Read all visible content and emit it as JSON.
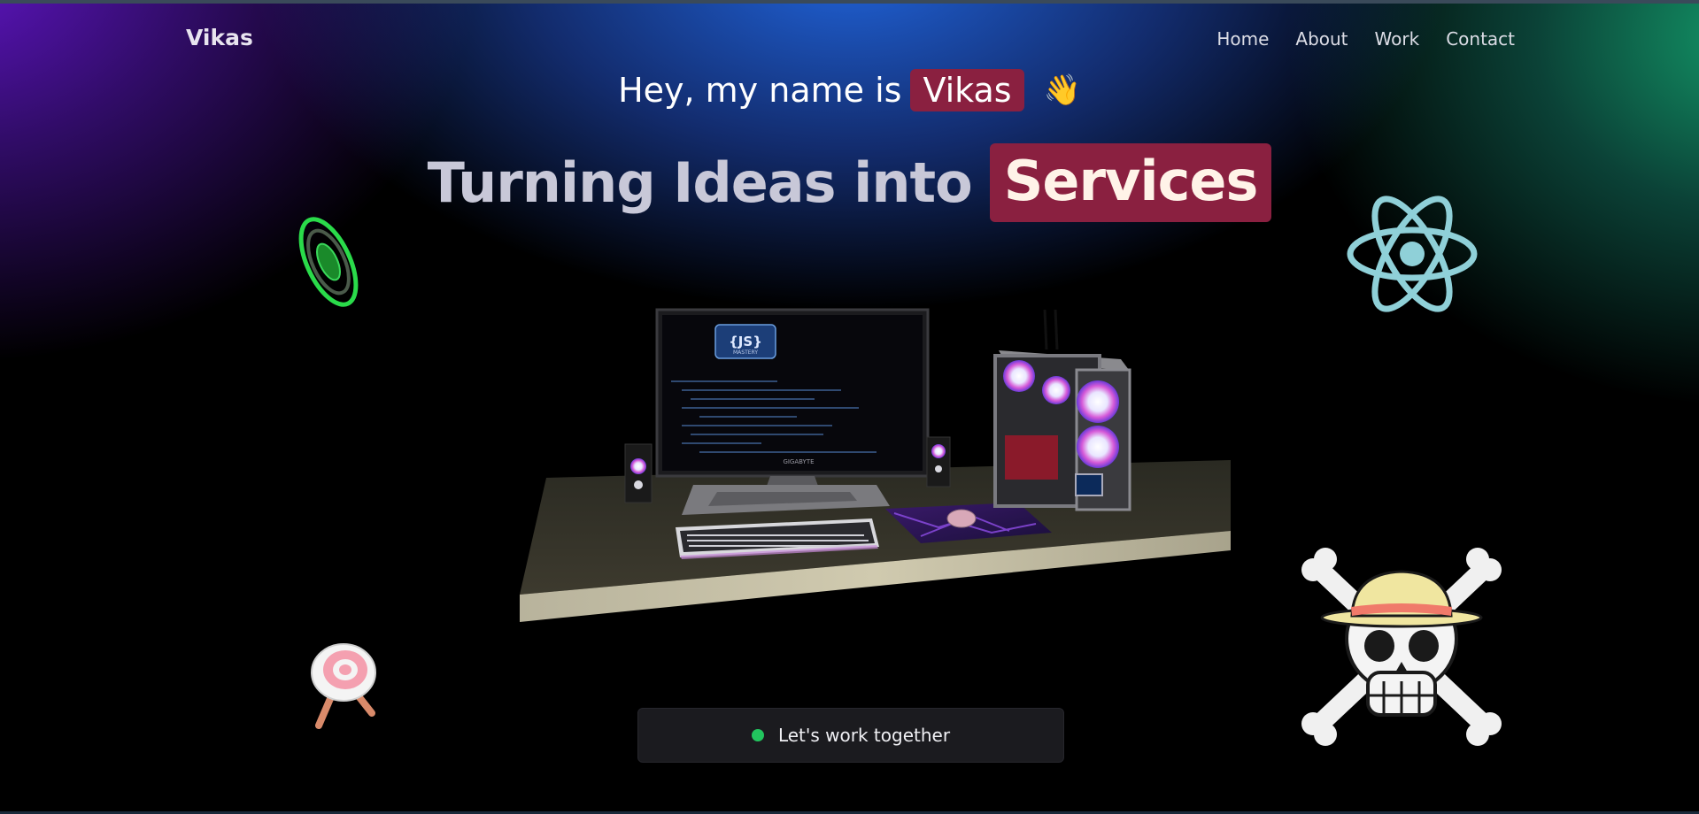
{
  "nav": {
    "logo": "Vikas",
    "links": [
      "Home",
      "About",
      "Work",
      "Contact"
    ]
  },
  "hero": {
    "greeting_prefix": "Hey, my name is",
    "greeting_name": "Vikas",
    "wave_emoji": "👋",
    "headline_lead": "Turning Ideas into",
    "headline_accent": "Services"
  },
  "cta": {
    "label": "Let's work together",
    "status_color": "#22c55e"
  },
  "scene": {
    "monitor_brand": "GIGABYTE",
    "screen_badge": "{JS}",
    "screen_badge_sub": "MASTERY"
  },
  "icons": [
    "ring-target-icon",
    "react-logo-icon",
    "archery-target-icon",
    "jolly-roger-icon"
  ],
  "colors": {
    "accent": "#8a2040",
    "gradient_purple": "#6616d2",
    "gradient_blue": "#2269e6",
    "gradient_green": "#14a06e"
  }
}
